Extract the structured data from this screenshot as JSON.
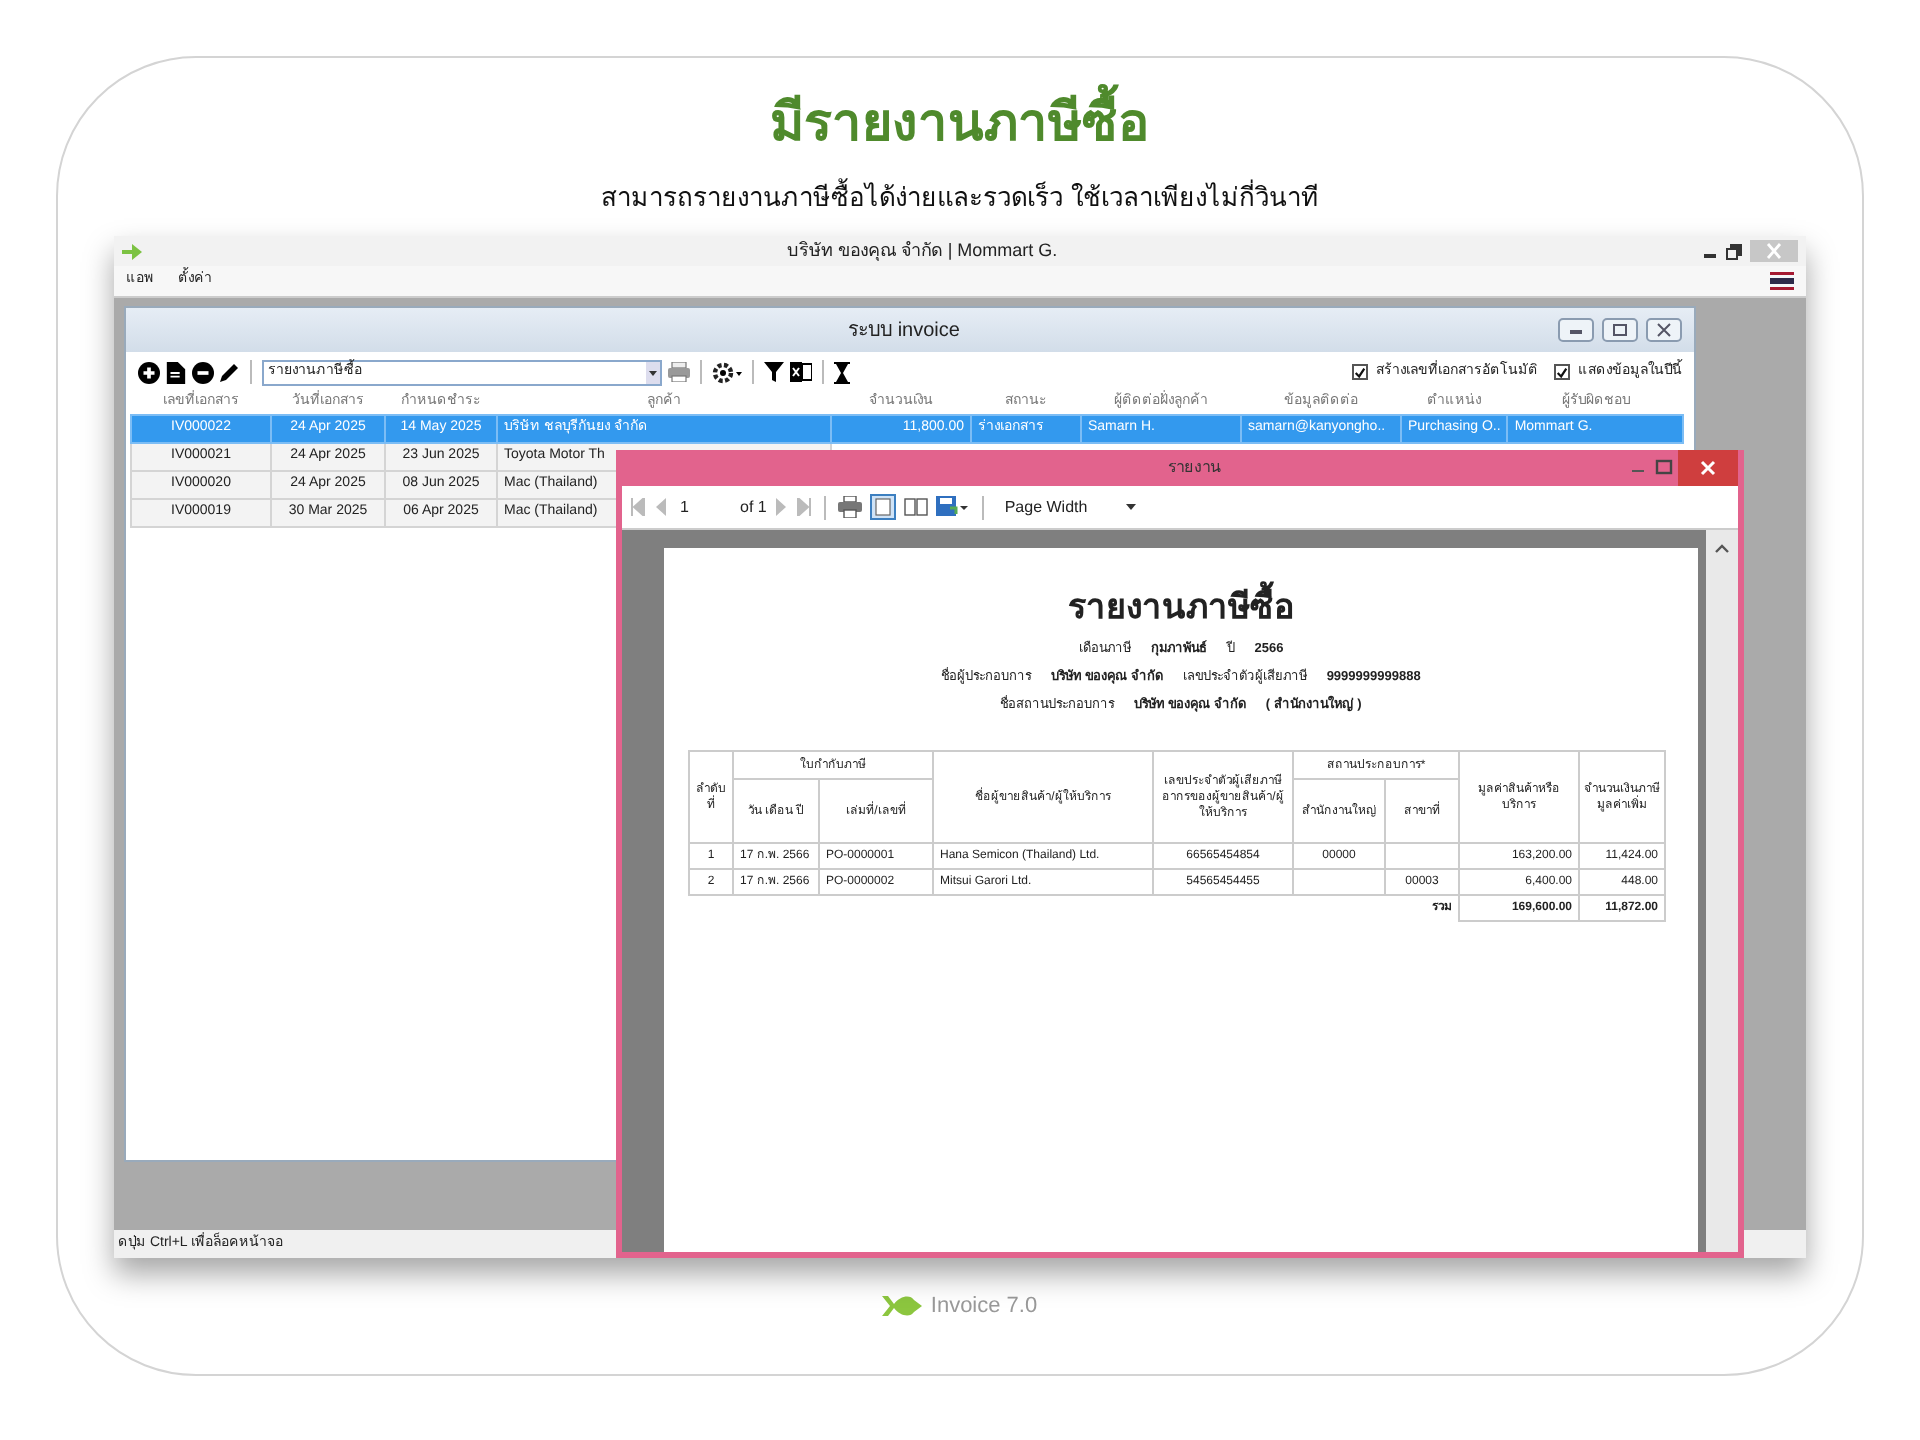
{
  "headline": "มีรายงานภาษีซื้อ",
  "subtitle": "สามารถรายงานภาษีซื้อได้ง่ายและรวดเร็ว ใช้เวลาเพียงไม่กี่วินาที",
  "app": {
    "title": "บริษัท ของคุณ จำกัด | Mommart G.",
    "menu": [
      "แอพ",
      "ตั้งค่า"
    ],
    "status_bar": "ดปุ่ม Ctrl+L เพื่อล็อคหน้าจอ"
  },
  "invoice_window": {
    "title": "ระบบ invoice",
    "report_select": "รายงานภาษีซื้อ",
    "options": [
      {
        "label": "สร้างเลขที่เอกสารอัตโนมัติ",
        "checked": true
      },
      {
        "label": "แสดงข้อมูลในปีนี้",
        "checked": true
      }
    ],
    "columns": [
      "เลขที่เอกสาร",
      "วันที่เอกสาร",
      "กำหนดชำระ",
      "ลูกค้า",
      "จำนวนเงิน",
      "สถานะ",
      "ผู้ติดต่อฝั่งลูกค้า",
      "ข้อมูลติดต่อ",
      "ตำแหน่ง",
      "ผู้รับผิดชอบ"
    ],
    "rows": [
      {
        "selected": true,
        "cells": [
          "IV000022",
          "24 Apr 2025",
          "14 May 2025",
          "บริษัท ชลบุรีกันยง จำกัด",
          "11,800.00",
          "ร่างเอกสาร",
          "Samarn H.",
          "samarn@kanyongho..",
          "Purchasing O..",
          "Mommart G."
        ]
      },
      {
        "selected": false,
        "cells": [
          "IV000021",
          "24 Apr 2025",
          "23 Jun 2025",
          "Toyota Motor Th"
        ]
      },
      {
        "selected": false,
        "cells": [
          "IV000020",
          "24 Apr 2025",
          "08 Jun 2025",
          "Mac (Thailand)"
        ]
      },
      {
        "selected": false,
        "cells": [
          "IV000019",
          "30 Mar 2025",
          "06 Apr 2025",
          "Mac (Thailand)"
        ]
      }
    ]
  },
  "report_window": {
    "title": "รายงาน",
    "page": "1",
    "page_count": "of 1",
    "zoom": "Page Width",
    "report": {
      "title": "รายงานภาษีซื้อ",
      "info_lines": [
        [
          {
            "kind": "label",
            "text": "เดือนภาษี"
          },
          {
            "kind": "value",
            "text": "กุมภาพันธ์"
          },
          {
            "kind": "label",
            "text": "ปี"
          },
          {
            "kind": "value",
            "text": "2566"
          }
        ],
        [
          {
            "kind": "label",
            "text": "ชื่อผู้ประกอบการ"
          },
          {
            "kind": "value",
            "text": "บริษัท ของคุณ จำกัด"
          },
          {
            "kind": "label",
            "text": "เลขประจำตัวผู้เสียภาษี"
          },
          {
            "kind": "value",
            "text": "9999999999888"
          }
        ],
        [
          {
            "kind": "label",
            "text": "ชื่อสถานประกอบการ"
          },
          {
            "kind": "value",
            "text": "บริษัท ของคุณ จำกัด"
          },
          {
            "kind": "value",
            "text": "( สำนักงานใหญ่ )"
          }
        ]
      ],
      "header_rows": [
        [
          {
            "text": "ลำดับที่",
            "rowspan": 2
          },
          {
            "text": "ใบกำกับภาษี",
            "colspan": 2
          },
          {
            "text": "ชื่อผู้ขายสินค้า/ผู้ให้บริการ",
            "rowspan": 2
          },
          {
            "text": "เลขประจำตัวผู้เสียภาษีอากรของผู้ขายสินค้า/ผู้ให้บริการ",
            "rowspan": 2
          },
          {
            "text": "สถานประกอบการ*",
            "colspan": 2
          },
          {
            "text": "มูลค่าสินค้าหรือบริการ",
            "rowspan": 2
          },
          {
            "text": "จำนวนเงินภาษีมูลค่าเพิ่ม",
            "rowspan": 2
          }
        ],
        [
          {
            "text": "วัน เดือน ปี"
          },
          {
            "text": "เล่มที่/เลขที่"
          },
          {
            "text": "สำนักงานใหญ่"
          },
          {
            "text": "สาขาที่"
          }
        ]
      ],
      "rows": [
        [
          "1",
          "17 ก.พ. 2566",
          "PO-0000001",
          "Hana Semicon (Thailand) Ltd.",
          "66565454854",
          "00000",
          null,
          "163,200.00",
          "11,424.00"
        ],
        [
          "2",
          "17 ก.พ. 2566",
          "PO-0000002",
          "Mitsui Garori Ltd.",
          "54565454455",
          null,
          "00003",
          "6,400.00",
          "448.00"
        ]
      ],
      "total": {
        "label": "รวม",
        "values": [
          "169,600.00",
          "11,872.00"
        ]
      }
    }
  },
  "footer": "Invoice 7.0"
}
